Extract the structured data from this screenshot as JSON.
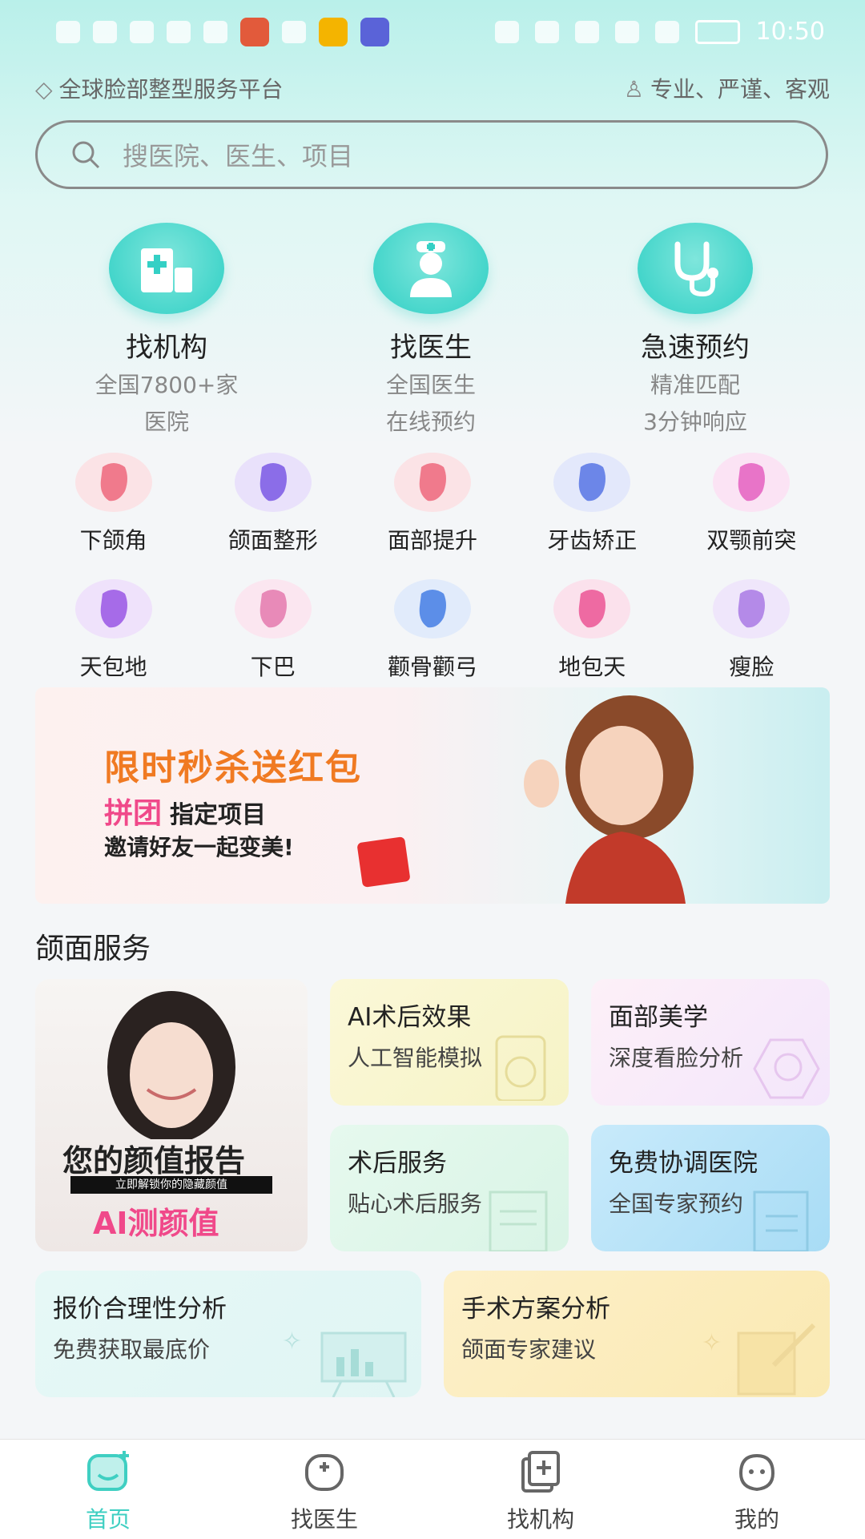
{
  "status_bar": {
    "time": "10:50"
  },
  "tagline": {
    "left": "全球脸部整型服务平台",
    "right": "专业、严谨、客观"
  },
  "search": {
    "placeholder": "搜医院、医生、项目"
  },
  "main_services": [
    {
      "title": "找机构",
      "sub1": "全国7800+家",
      "sub2": "医院",
      "icon": "hospital-icon"
    },
    {
      "title": "找医生",
      "sub1": "全国医生",
      "sub2": "在线预约",
      "icon": "doctor-icon"
    },
    {
      "title": "急速预约",
      "sub1": "精准匹配",
      "sub2": "3分钟响应",
      "icon": "stethoscope-icon"
    }
  ],
  "categories": [
    {
      "label": "下颌角",
      "color": "#f07a8c"
    },
    {
      "label": "颌面整形",
      "color": "#8b6de8"
    },
    {
      "label": "面部提升",
      "color": "#f07a8c"
    },
    {
      "label": "牙齿矫正",
      "color": "#6c86e8"
    },
    {
      "label": "双颚前突",
      "color": "#e874c8"
    },
    {
      "label": "天包地",
      "color": "#a66be8"
    },
    {
      "label": "下巴",
      "color": "#e88ab8"
    },
    {
      "label": "颧骨颧弓",
      "color": "#5c8ee8"
    },
    {
      "label": "地包天",
      "color": "#ee6aa2"
    },
    {
      "label": "瘦脸",
      "color": "#b48ae8"
    }
  ],
  "banner": {
    "title": "限时秒杀送红包",
    "line2_strong": "拼团",
    "line2": "指定项目",
    "line3": "邀请好友一起变美!"
  },
  "section": {
    "title": "颌面服务"
  },
  "report_card": {
    "title": "您的颜值报告",
    "sub": "立即解锁你的隐藏颜值",
    "cta": "AI测颜值"
  },
  "service_cards": [
    {
      "title": "AI术后效果",
      "sub": "人工智能模拟"
    },
    {
      "title": "面部美学",
      "sub": "深度看脸分析"
    },
    {
      "title": "术后服务",
      "sub": "贴心术后服务"
    },
    {
      "title": "免费协调医院",
      "sub": "全国专家预约"
    },
    {
      "title": "报价合理性分析",
      "sub": "免费获取最底价"
    },
    {
      "title": "手术方案分析",
      "sub": "颌面专家建议"
    }
  ],
  "bottom_nav": [
    {
      "label": "首页",
      "active": true
    },
    {
      "label": "找医生"
    },
    {
      "label": "找机构"
    },
    {
      "label": "我的"
    }
  ],
  "colors": {
    "accent": "#3fcfc2",
    "banner_orange": "#f07a22",
    "pink": "#f0498a"
  }
}
